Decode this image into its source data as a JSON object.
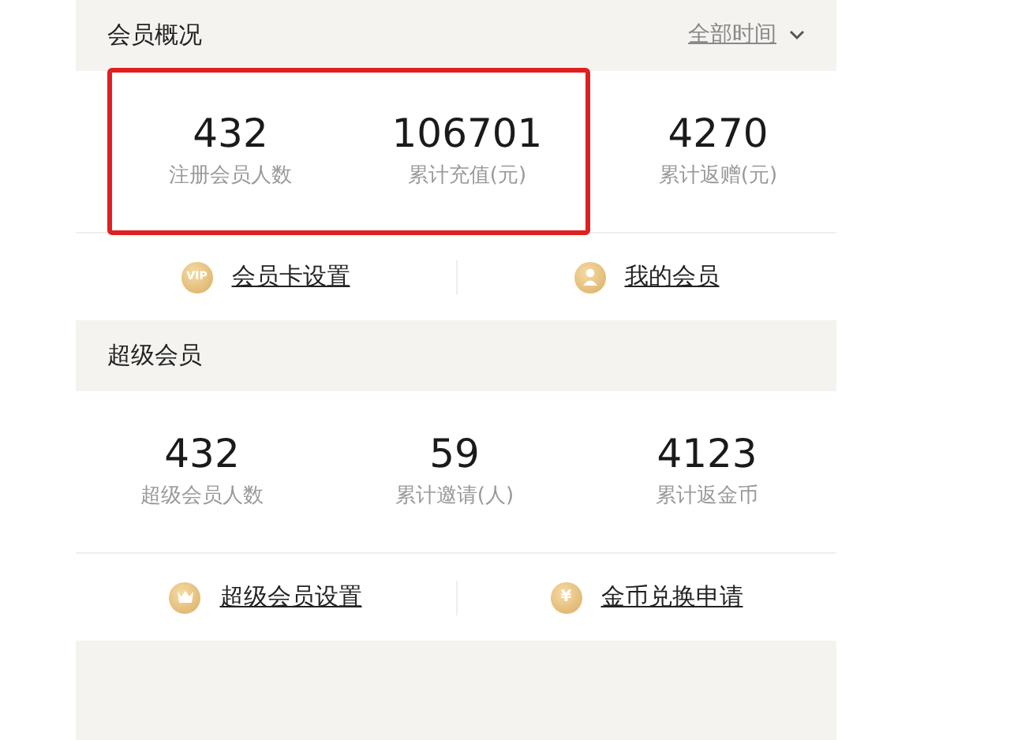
{
  "sections": [
    {
      "title": "会员概况",
      "filter": {
        "label": "全部时间"
      },
      "stats": [
        {
          "value": "432",
          "label": "注册会员人数",
          "highlighted": true
        },
        {
          "value": "106701",
          "label": "累计充值(元)",
          "highlighted": true
        },
        {
          "value": "4270",
          "label": "累计返赠(元)",
          "highlighted": false
        }
      ],
      "links": [
        {
          "label": "会员卡设置",
          "icon": {
            "kind": "vip",
            "text": "VIP"
          }
        },
        {
          "label": "我的会员",
          "icon": {
            "kind": "person"
          }
        }
      ]
    },
    {
      "title": "超级会员",
      "stats": [
        {
          "value": "432",
          "label": "超级会员人数",
          "highlighted": false
        },
        {
          "value": "59",
          "label": "累计邀请(人)",
          "highlighted": false
        },
        {
          "value": "4123",
          "label": "累计返金币",
          "highlighted": false
        }
      ],
      "links": [
        {
          "label": "超级会员设置",
          "icon": {
            "kind": "crown"
          }
        },
        {
          "label": "金币兑换申请",
          "icon": {
            "kind": "coin",
            "text": "¥"
          }
        }
      ]
    }
  ]
}
